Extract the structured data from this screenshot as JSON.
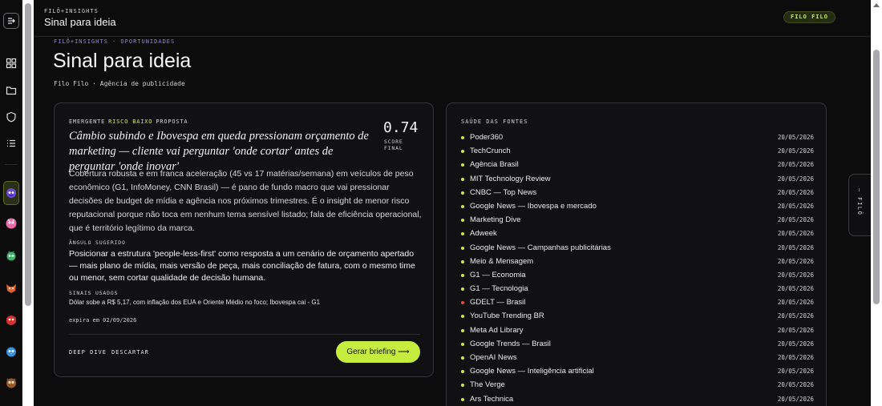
{
  "header": {
    "kicker": "FILÔ+INSIGHTS",
    "title": "Sinal para ideia",
    "client_badge": "FILO FILO"
  },
  "page": {
    "breadcrumb": "FILÔ+INSIGHTS · OPORTUNIDADES",
    "title": "Sinal para ideia",
    "subtitle": "Filo Filo · Agência de publicidade"
  },
  "rail": {
    "icons": [
      "panel-toggle-icon",
      "grid-icon",
      "folder-icon",
      "shield-icon",
      "list-icon"
    ],
    "agent_avatars": [
      "purple-robot",
      "pink-monster",
      "green-alien",
      "orange-fox",
      "red-bug",
      "blue-bird",
      "brown-owl"
    ]
  },
  "idea": {
    "tag_stage": "EMERGENTE",
    "tag_risk": "RISCO BAIXO",
    "tag_type": "PROPOSTA",
    "headline": "Câmbio subindo e Ibovespa em queda pressionam orçamento de marketing — cliente vai perguntar 'onde cortar' antes de perguntar 'onde inovar'",
    "score_value": "0.74",
    "score_label": "SCORE FINAL",
    "body": "Cobertura robusta e em franca aceleração (45 vs 17 matérias/semana) em veículos de peso econômico (G1, InfoMoney, CNN Brasil) — é pano de fundo macro que vai pressionar decisões de budget de mídia e agência nos próximos trimestres. É o insight de menor risco reputacional porque não toca em nenhum tema sensível listado; fala de eficiência operacional, que é território legítimo da marca.",
    "angle_label": "ÂNGULO SUGERIDO",
    "angle": "Posicionar a estrutura 'people-less-first' como resposta a um cenário de orçamento apertado — mais plano de mídia, mais versão de peça, mais conciliação de fatura, com o mesmo time ou menor, sem cortar qualidade de decisão humana.",
    "signals_label": "SINAIS USADOS",
    "signals": "Dólar sobe a R$ 5,17, com inflação dos EUA e Oriente Médio no foco; Ibovespa cai - G1",
    "expiry": "expira em 02/09/2026",
    "action_deep_dive": "DEEP DIVE",
    "action_discard": "DESCARTAR",
    "cta": "Gerar briefing ⟶"
  },
  "sources": {
    "title": "SAÚDE DAS FONTES",
    "colors": {
      "ok": "#c6ec3e",
      "error": "#e24b3b"
    },
    "items": [
      {
        "name": "Poder360",
        "date": "20/05/2026",
        "status": "ok"
      },
      {
        "name": "TechCrunch",
        "date": "20/05/2026",
        "status": "ok"
      },
      {
        "name": "Agência Brasil",
        "date": "20/05/2026",
        "status": "ok"
      },
      {
        "name": "MIT Technology Review",
        "date": "20/05/2026",
        "status": "ok"
      },
      {
        "name": "CNBC — Top News",
        "date": "20/05/2026",
        "status": "ok"
      },
      {
        "name": "Google News — Ibovespa e mercado",
        "date": "20/05/2026",
        "status": "ok"
      },
      {
        "name": "Marketing Dive",
        "date": "20/05/2026",
        "status": "ok"
      },
      {
        "name": "Adweek",
        "date": "20/05/2026",
        "status": "ok"
      },
      {
        "name": "Google News — Campanhas publicitárias",
        "date": "20/05/2026",
        "status": "ok"
      },
      {
        "name": "Meio & Mensagem",
        "date": "20/05/2026",
        "status": "ok"
      },
      {
        "name": "G1 — Economia",
        "date": "20/05/2026",
        "status": "ok"
      },
      {
        "name": "G1 — Tecnologia",
        "date": "20/05/2026",
        "status": "ok"
      },
      {
        "name": "GDELT — Brasil",
        "date": "20/05/2026",
        "status": "error"
      },
      {
        "name": "YouTube Trending BR",
        "date": "20/05/2026",
        "status": "ok"
      },
      {
        "name": "Meta Ad Library",
        "date": "20/05/2026",
        "status": "ok"
      },
      {
        "name": "Google Trends — Brasil",
        "date": "20/05/2026",
        "status": "ok"
      },
      {
        "name": "OpenAI News",
        "date": "20/05/2026",
        "status": "ok"
      },
      {
        "name": "Google News — Inteligência artificial",
        "date": "20/05/2026",
        "status": "ok"
      },
      {
        "name": "The Verge",
        "date": "20/05/2026",
        "status": "ok"
      },
      {
        "name": "Ars Technica",
        "date": "20/05/2026",
        "status": "ok"
      }
    ]
  },
  "sidetab": {
    "label": "— FILÔ"
  }
}
